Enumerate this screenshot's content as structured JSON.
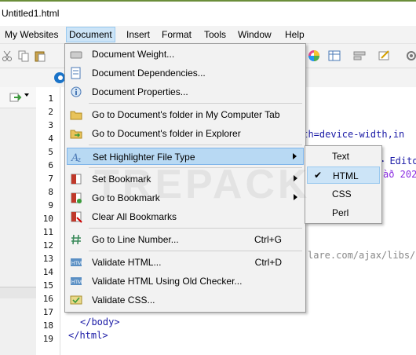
{
  "window": {
    "title": "Untitled1.html"
  },
  "menubar": {
    "items": [
      {
        "label": "My Websites"
      },
      {
        "label": "Document"
      },
      {
        "label": "Insert"
      },
      {
        "label": "Format"
      },
      {
        "label": "Tools"
      },
      {
        "label": "Window"
      },
      {
        "label": "Help"
      }
    ]
  },
  "gutter": {
    "line_numbers": [
      "1",
      "2",
      "3",
      "4",
      "5",
      "6",
      "7",
      "8",
      "9",
      "10",
      "11",
      "12",
      "13",
      "14",
      "15",
      "16",
      "17",
      "18",
      "19"
    ]
  },
  "code": {
    "line5_tail": "dth=device-width,in",
    "line6_tail": "> Edito",
    "line7_tail": "àð 202",
    "line13_tail": "lare.com/ajax/libs/",
    "line18": "</body>",
    "line19": "</html>"
  },
  "document_menu": {
    "items": [
      {
        "label": "Document Weight...",
        "icon": "weight-icon"
      },
      {
        "label": "Document Dependencies...",
        "icon": "dependencies-icon"
      },
      {
        "label": "Document Properties...",
        "icon": "properties-icon"
      },
      {
        "label": "Go to Document's folder in My Computer Tab",
        "icon": "folder-icon"
      },
      {
        "label": "Go to Document's folder in Explorer",
        "icon": "folder-arrow-icon"
      },
      {
        "label": "Set Highlighter File Type",
        "icon": "highlighter-icon"
      },
      {
        "label": "Set Bookmark",
        "icon": "bookmark-set-icon"
      },
      {
        "label": "Go to Bookmark",
        "icon": "bookmark-go-icon"
      },
      {
        "label": "Clear All Bookmarks",
        "icon": "bookmark-clear-icon"
      },
      {
        "label": "Go to Line Number...",
        "shortcut": "Ctrl+G",
        "icon": "hash-icon"
      },
      {
        "label": "Validate HTML...",
        "shortcut": "Ctrl+D",
        "icon": "validate-html-icon"
      },
      {
        "label": "Validate HTML Using Old Checker...",
        "icon": "validate-old-icon"
      },
      {
        "label": "Validate CSS...",
        "icon": "validate-css-icon"
      }
    ]
  },
  "highlighter_submenu": {
    "items": [
      {
        "label": "Text"
      },
      {
        "label": "HTML",
        "checked": "✔"
      },
      {
        "label": "CSS"
      },
      {
        "label": "Perl"
      }
    ]
  },
  "watermark": "TREPACK",
  "colors": {
    "highlight": "#b8d9f3",
    "menu_bg": "#f2f2f2",
    "accent": "#6b8e3a"
  }
}
